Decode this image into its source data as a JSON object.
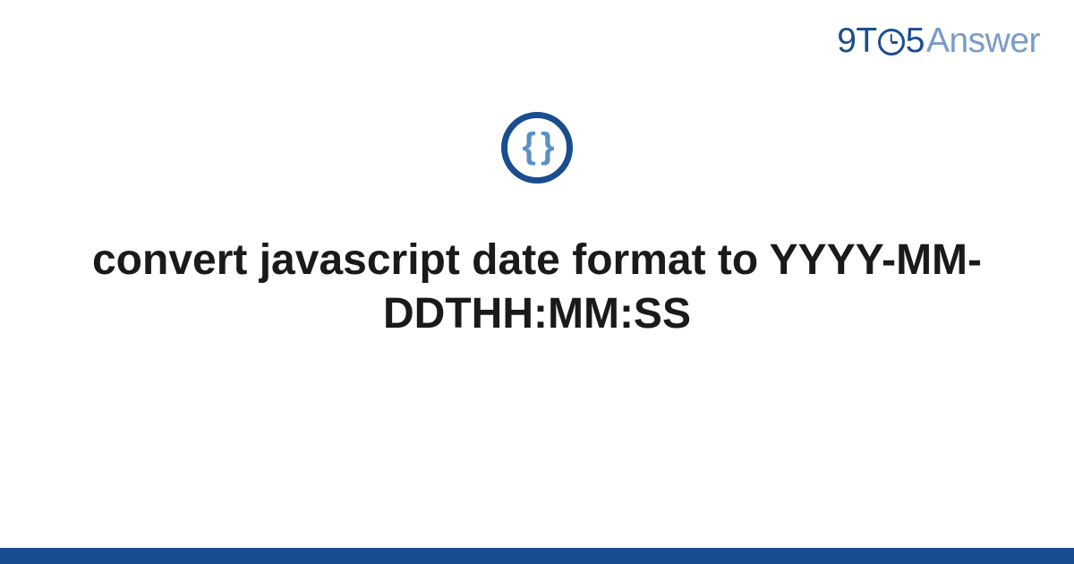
{
  "logo": {
    "part1": "9T",
    "part2": "5",
    "part3": "Answer"
  },
  "icon": {
    "braces": "{ }"
  },
  "title": "convert javascript date format to YYYY-MM-DDTHH:MM:SS",
  "colors": {
    "primary": "#1a4d8f",
    "secondary": "#7a9cc6",
    "braces": "#5b8fc7"
  }
}
